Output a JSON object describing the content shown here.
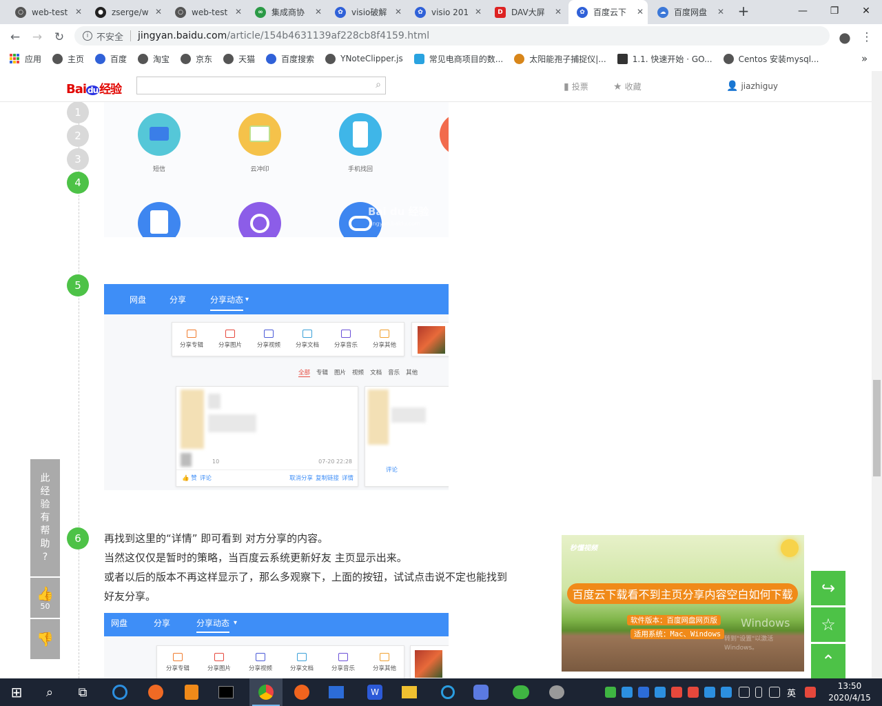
{
  "browser": {
    "tabs": [
      {
        "label": "web-test",
        "favicon_color": "#555"
      },
      {
        "label": "zserge/w",
        "favicon_color": "#222"
      },
      {
        "label": "web-test",
        "favicon_color": "#555"
      },
      {
        "label": "集成商协",
        "favicon_color": "#2b9a46"
      },
      {
        "label": "visio破解",
        "favicon_color": "#3061d8"
      },
      {
        "label": "visio 201",
        "favicon_color": "#3061d8"
      },
      {
        "label": "DAV大屏",
        "favicon_color": "#d22"
      },
      {
        "label": "百度云下",
        "favicon_color": "#3061d8"
      },
      {
        "label": "百度网盘",
        "favicon_color": "#3c78d8"
      }
    ],
    "new_tab": "+",
    "window_controls": {
      "minimize": "—",
      "maximize": "❐",
      "close": "✕"
    },
    "nav": {
      "back": "←",
      "forward": "→",
      "reload": "↻"
    },
    "address": {
      "security_label": "不安全",
      "host": "jingyan.baidu.com",
      "path": "/article/154b4631139af228cb8f4159.html"
    },
    "bookmark_star": "☆",
    "profile": "●",
    "menu": "⋮",
    "bookmarks": [
      {
        "label": "应用",
        "color": "#e44"
      },
      {
        "label": "主页",
        "color": "#555"
      },
      {
        "label": "百度",
        "color": "#3061d8"
      },
      {
        "label": "淘宝",
        "color": "#555"
      },
      {
        "label": "京东",
        "color": "#555"
      },
      {
        "label": "天猫",
        "color": "#555"
      },
      {
        "label": "百度搜索",
        "color": "#3061d8"
      },
      {
        "label": "YNoteClipper.js",
        "color": "#555"
      },
      {
        "label": "常见电商项目的数...",
        "color": "#2aa3e0"
      },
      {
        "label": "太阳能孢子捕捉仪|...",
        "color": "#d8861a"
      },
      {
        "label": "1.1. 快速开始 · GO...",
        "color": "#333"
      },
      {
        "label": "Centos 安装mysql...",
        "color": "#555"
      }
    ],
    "bookmarks_more": "»"
  },
  "site": {
    "logo": {
      "bai": "Bai",
      "du": "du",
      "jingyan": "经验"
    },
    "search_placeholder": "",
    "search_icon": "⌕",
    "vote": "投票",
    "favorite": "收藏",
    "user": "jiazhiguy"
  },
  "steps": {
    "numbers": [
      "1",
      "2",
      "3",
      "4",
      "5",
      "6"
    ]
  },
  "screenshot4": {
    "apps": [
      {
        "label": "短信",
        "color": "#55c7d8"
      },
      {
        "label": "云冲印",
        "color": "#f5c24a"
      },
      {
        "label": "手机找回",
        "color": "#3fb6e8"
      },
      {
        "label": "",
        "color": "#f26b4d"
      },
      {
        "label": "",
        "color": "#3e86f0"
      },
      {
        "label": "",
        "color": "#8c5de8"
      },
      {
        "label": "",
        "color": "#3e86f0"
      }
    ],
    "watermark": "Bai du 经验",
    "watermark_url": "jingyan.baidu.com"
  },
  "screenshot5": {
    "nav": [
      "网盘",
      "分享",
      "分享动态"
    ],
    "nav_caret": "▾",
    "share_types": [
      {
        "label": "分享专辑",
        "color": "#f07c2e"
      },
      {
        "label": "分享图片",
        "color": "#e6483c"
      },
      {
        "label": "分享视频",
        "color": "#4a5ad8"
      },
      {
        "label": "分享文档",
        "color": "#3aa0d8"
      },
      {
        "label": "分享音乐",
        "color": "#6a4fd8"
      },
      {
        "label": "分享其他",
        "color": "#f0a02e"
      }
    ],
    "filters": [
      "全部",
      "专辑",
      "图片",
      "视频",
      "文档",
      "音乐",
      "其他"
    ],
    "card_date": "07-20 22:28",
    "card_number": "10",
    "like": "赞",
    "comment": "评论",
    "actions": [
      "取消分享",
      "复制链接",
      "详情"
    ],
    "right_card_label": "评论"
  },
  "step6": {
    "lines": [
      "再找到这里的“详情” 即可看到 对方分享的内容。",
      "当然这仅仅是暂时的策略，当百度云系统更新好友 主页显示出来。",
      "或者以后的版本不再这样显示了，那么多观察下，上面的按钮，试试点击说不定也能找到",
      "好友分享。"
    ]
  },
  "screenshot6": {
    "nav": [
      "网盘",
      "分享",
      "分享动态"
    ],
    "share_types": [
      "分享专辑",
      "分享图片",
      "分享视频",
      "分享文档",
      "分享音乐",
      "分享其他"
    ]
  },
  "helppanel": {
    "question": [
      "此",
      "经",
      "验",
      "有",
      "帮",
      "助",
      "?"
    ],
    "like_icon": "👍",
    "like_count": "50",
    "dislike_icon": "👎"
  },
  "ad": {
    "brand": "秒懂视频",
    "title": "百度云下载看不到主页分享内容空白如何下载",
    "version": "软件版本：百度网盘网页版",
    "system": "适用系统：Mac、Windows",
    "windows_watermark": "Windows",
    "windows_sub": "转到\"设置\"以激活 Windows。"
  },
  "sidebuttons": {
    "share": "↪",
    "favorite": "☆",
    "top": "⌃"
  },
  "taskbar": {
    "start": "⊞",
    "search": "⌕",
    "taskview": "⧉",
    "apps": [
      {
        "name": "ie",
        "color": "#2c8fe0"
      },
      {
        "name": "firefox",
        "color": "#f06a24"
      },
      {
        "name": "sublime",
        "color": "#f08a19"
      },
      {
        "name": "terminal",
        "color": "#222"
      },
      {
        "name": "chrome",
        "color": "#e44"
      },
      {
        "name": "pen",
        "color": "#f0641e"
      },
      {
        "name": "app",
        "color": "#2c6cd8"
      },
      {
        "name": "wps",
        "color": "#2c5ad8"
      },
      {
        "name": "explorer",
        "color": "#f0c030"
      },
      {
        "name": "search-app",
        "color": "#2a9de0"
      },
      {
        "name": "vscode-like",
        "color": "#5b7ae0"
      },
      {
        "name": "wechat",
        "color": "#3fb542"
      },
      {
        "name": "paint",
        "color": "#999"
      }
    ],
    "tray_colors": [
      "#3fb542",
      "#2c8fe0",
      "#2c6cd8",
      "#2c8fe0",
      "#e6483c",
      "#e6483c",
      "#2c8fe0",
      "#2c8fe0",
      "#ddd",
      "#ddd",
      "#ddd"
    ],
    "ime": "英",
    "time": "13:50",
    "date": "2020/4/15"
  },
  "colors": {
    "green": "#4dc247",
    "blue_bar": "#3e8ef7",
    "baidu_red": "#e10601",
    "baidu_blue": "#2932e1"
  }
}
